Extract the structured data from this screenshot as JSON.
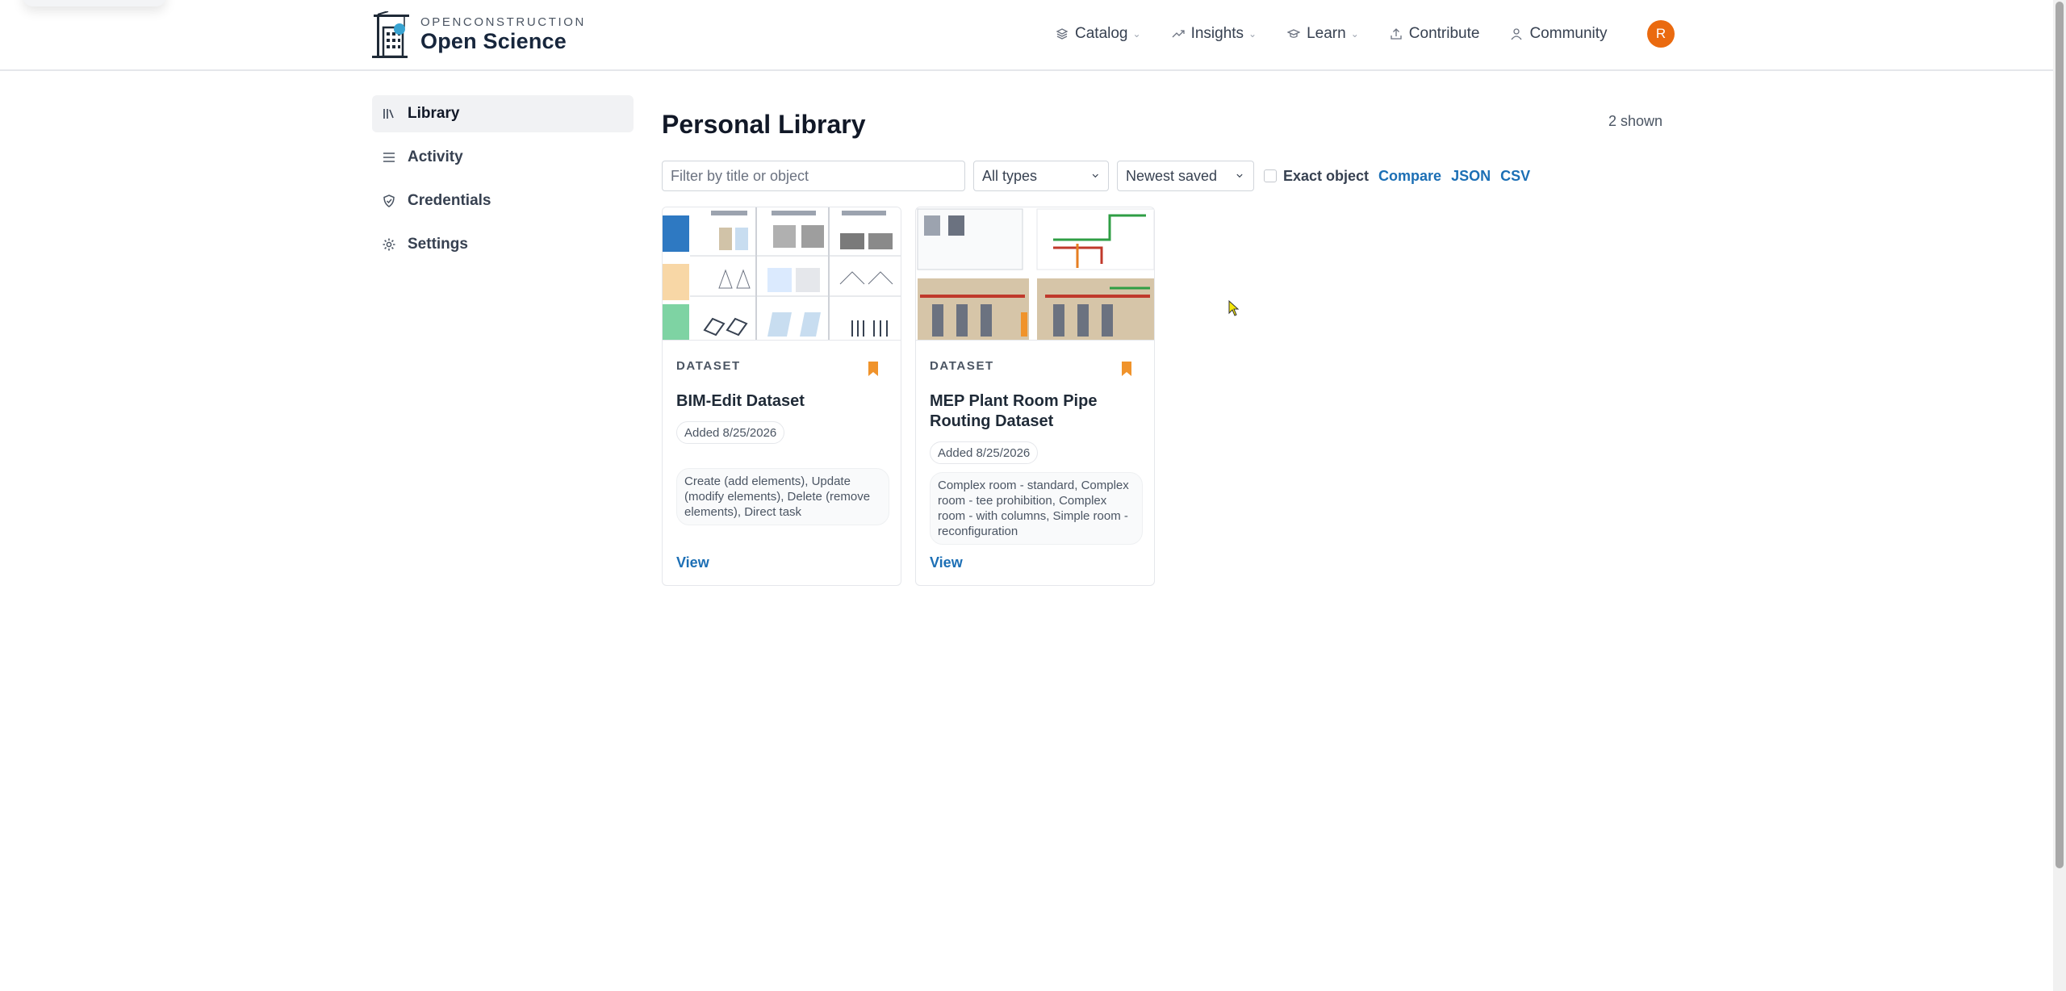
{
  "brand": {
    "top": "OPENCONSTRUCTION",
    "main": "Open Science"
  },
  "nav": [
    {
      "label": "Catalog",
      "caret": "⌄",
      "icon": "layers-icon"
    },
    {
      "label": "Insights",
      "caret": "⌄",
      "icon": "trend-icon"
    },
    {
      "label": "Learn",
      "caret": "⌄",
      "icon": "graduation-cap-icon"
    },
    {
      "label": "Contribute",
      "caret": "",
      "icon": "upload-icon"
    },
    {
      "label": "Community",
      "caret": "",
      "icon": "user-icon"
    }
  ],
  "user": {
    "initial": "R",
    "color": "#ea6a0f"
  },
  "sidebar": {
    "items": [
      {
        "label": "Library",
        "icon": "library-icon"
      },
      {
        "label": "Activity",
        "icon": "list-icon"
      },
      {
        "label": "Credentials",
        "icon": "shield-icon"
      },
      {
        "label": "Settings",
        "icon": "gear-icon"
      }
    ]
  },
  "main": {
    "title": "Personal Library",
    "count": "2 shown",
    "toolbar": {
      "filter_placeholder": "Filter by title or object",
      "type_select": "All types",
      "sort_select": "Newest saved",
      "exact_label": "Exact object",
      "compare": "Compare",
      "json": "JSON",
      "csv": "CSV"
    },
    "cards": [
      {
        "kind": "DATASET",
        "title": "BIM-Edit Dataset",
        "added": "Added 8/25/2026",
        "tags": "Create (add elements), Update (modify elements), Delete (remove elements), Direct task",
        "view": "View"
      },
      {
        "kind": "DATASET",
        "title": "MEP Plant Room Pipe Routing Dataset",
        "added": "Added 8/25/2026",
        "tags": "Complex room - standard, Complex room - tee prohibition, Complex room - with columns, Simple room - reconfiguration",
        "view": "View"
      }
    ]
  },
  "colors": {
    "link": "#1c6fb5",
    "bookmark": "#f0932b",
    "active_bg": "#f1f2f4"
  }
}
